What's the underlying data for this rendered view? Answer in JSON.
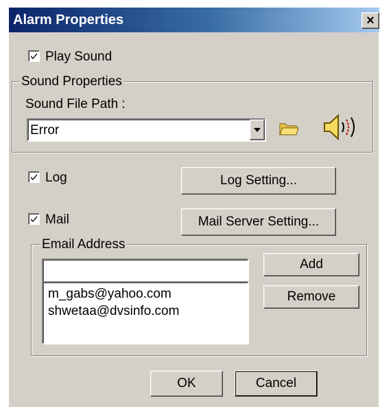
{
  "window": {
    "title": "Alarm Properties",
    "close_label": "×"
  },
  "play_sound": {
    "label": "Play Sound",
    "checked": true
  },
  "sound_properties": {
    "group_label": "Sound Properties",
    "path_label": "Sound File Path :",
    "selected_value": "Error",
    "folder_icon": "folder-icon",
    "speaker_icon": "speaker-icon"
  },
  "log": {
    "label": "Log",
    "checked": true,
    "button_label": "Log Setting..."
  },
  "mail": {
    "label": "Mail",
    "checked": true,
    "button_label": "Mail Server Setting..."
  },
  "email": {
    "group_label": "Email Address",
    "input_value": "",
    "add_label": "Add",
    "remove_label": "Remove",
    "addresses": [
      "m_gabs@yahoo.com",
      "shwetaa@dvsinfo.com"
    ]
  },
  "footer": {
    "ok_label": "OK",
    "cancel_label": "Cancel"
  },
  "colors": {
    "dialog_bg": "#d4d0c8",
    "title_start": "#0a246a",
    "title_end": "#a6caf0"
  }
}
